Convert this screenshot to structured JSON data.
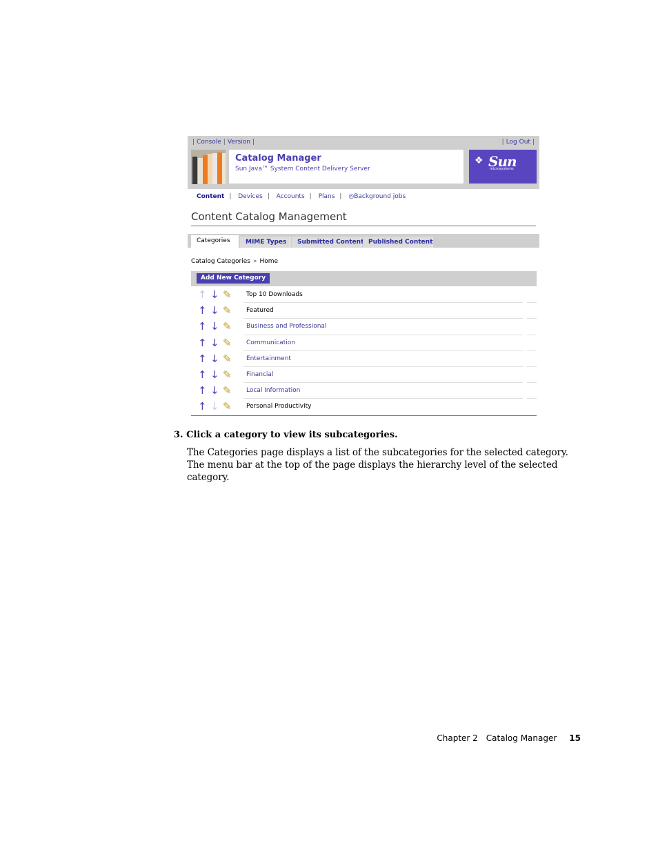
{
  "topbar": {
    "console": "Console",
    "version": "Version",
    "logout": "Log Out"
  },
  "header": {
    "title": "Catalog Manager",
    "subtitle": "Sun Java™ System Content Delivery Server",
    "brand": "Sun",
    "brand_sub": "microsystems"
  },
  "nav": {
    "items": [
      "Content",
      "Devices",
      "Accounts",
      "Plans",
      "Background jobs"
    ]
  },
  "page_title": "Content Catalog Management",
  "tabs": [
    "Categories",
    "MIME Types",
    "Submitted Content",
    "Published Content"
  ],
  "breadcrumb": {
    "root": "Catalog Categories",
    "current": "Home"
  },
  "add_button": "Add New Category",
  "categories": [
    {
      "name": "Top 10 Downloads",
      "up_enabled": false,
      "down_enabled": true
    },
    {
      "name": "Featured",
      "up_enabled": true,
      "down_enabled": true
    },
    {
      "name": "Business and Professional",
      "up_enabled": true,
      "down_enabled": true
    },
    {
      "name": "Communication",
      "up_enabled": true,
      "down_enabled": true
    },
    {
      "name": "Entertainment",
      "up_enabled": true,
      "down_enabled": true
    },
    {
      "name": "Financial",
      "up_enabled": true,
      "down_enabled": true
    },
    {
      "name": "Local Information",
      "up_enabled": true,
      "down_enabled": true
    },
    {
      "name": "Personal Productivity",
      "up_enabled": true,
      "down_enabled": false
    }
  ],
  "doc": {
    "step": "3.  Click a category to view its subcategories.",
    "paragraph": "The Categories page displays a list of the subcategories for the selected category. The menu bar at the top of the page displays the hierarchy level of the selected category."
  },
  "footer": {
    "chapter": "Chapter 2",
    "title": "Catalog Manager",
    "page": "15"
  },
  "colors": {
    "accent": "#4a3fb0",
    "bar": "#cfcfcf"
  }
}
